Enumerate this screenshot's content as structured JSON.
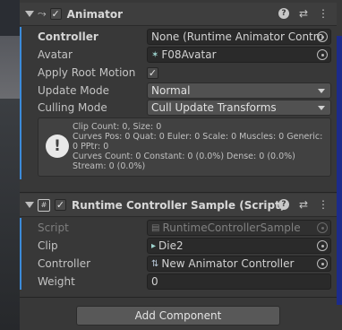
{
  "animator": {
    "title": "Animator",
    "controller": {
      "label": "Controller",
      "value": "None (Runtime Animator Contro"
    },
    "avatar": {
      "label": "Avatar",
      "value": "F08Avatar"
    },
    "apply_root_motion": {
      "label": "Apply Root Motion",
      "checked": true
    },
    "update_mode": {
      "label": "Update Mode",
      "value": "Normal"
    },
    "culling_mode": {
      "label": "Culling Mode",
      "value": "Cull Update Transforms"
    },
    "info_lines": [
      "Clip Count: 0, Size: 0",
      "Curves Pos: 0 Quat: 0 Euler: 0 Scale: 0 Muscles: 0 Generic:",
      "0 PPtr: 0",
      "Curves Count: 0 Constant: 0 (0.0%) Dense: 0 (0.0%)",
      "Stream: 0 (0.0%)"
    ]
  },
  "sample": {
    "title": "Runtime Controller Sample (Script)",
    "script": {
      "label": "Script",
      "value": "RuntimeControllerSample"
    },
    "clip": {
      "label": "Clip",
      "value": "Die2"
    },
    "controller": {
      "label": "Controller",
      "value": "New Animator Controller"
    },
    "weight": {
      "label": "Weight",
      "value": "0"
    }
  },
  "add_component_label": "Add Component",
  "check_mark": "✓",
  "colors": {
    "background": "#383838",
    "header": "#3e3e3e",
    "field": "#2a2a2a",
    "accent": "#3c8bd9"
  }
}
